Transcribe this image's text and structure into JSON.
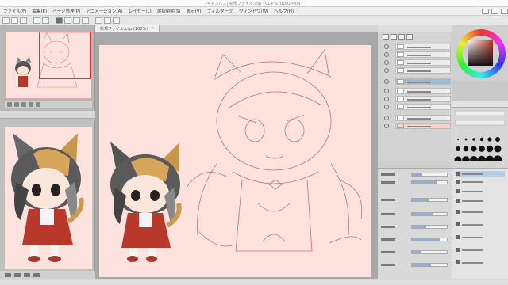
{
  "window": {
    "title": "[キャンバス] 新規ファイル.clip - CLIP STUDIO PAINT"
  },
  "menu": {
    "items": [
      "ファイル(F)",
      "編集(E)",
      "ページ管理(P)",
      "アニメーション(A)",
      "レイヤー(L)",
      "選択範囲(S)",
      "表示(V)",
      "フィルター(I)",
      "ウィンドウ(W)",
      "ヘルプ(H)"
    ]
  },
  "canvas": {
    "tab_label": "新規ファイル.clip (100%)",
    "background_color": "#fde2de",
    "sketch_color": "#c0615a"
  },
  "colors": {
    "main_color": "#c03a2a",
    "selection": "#9dbad6"
  }
}
